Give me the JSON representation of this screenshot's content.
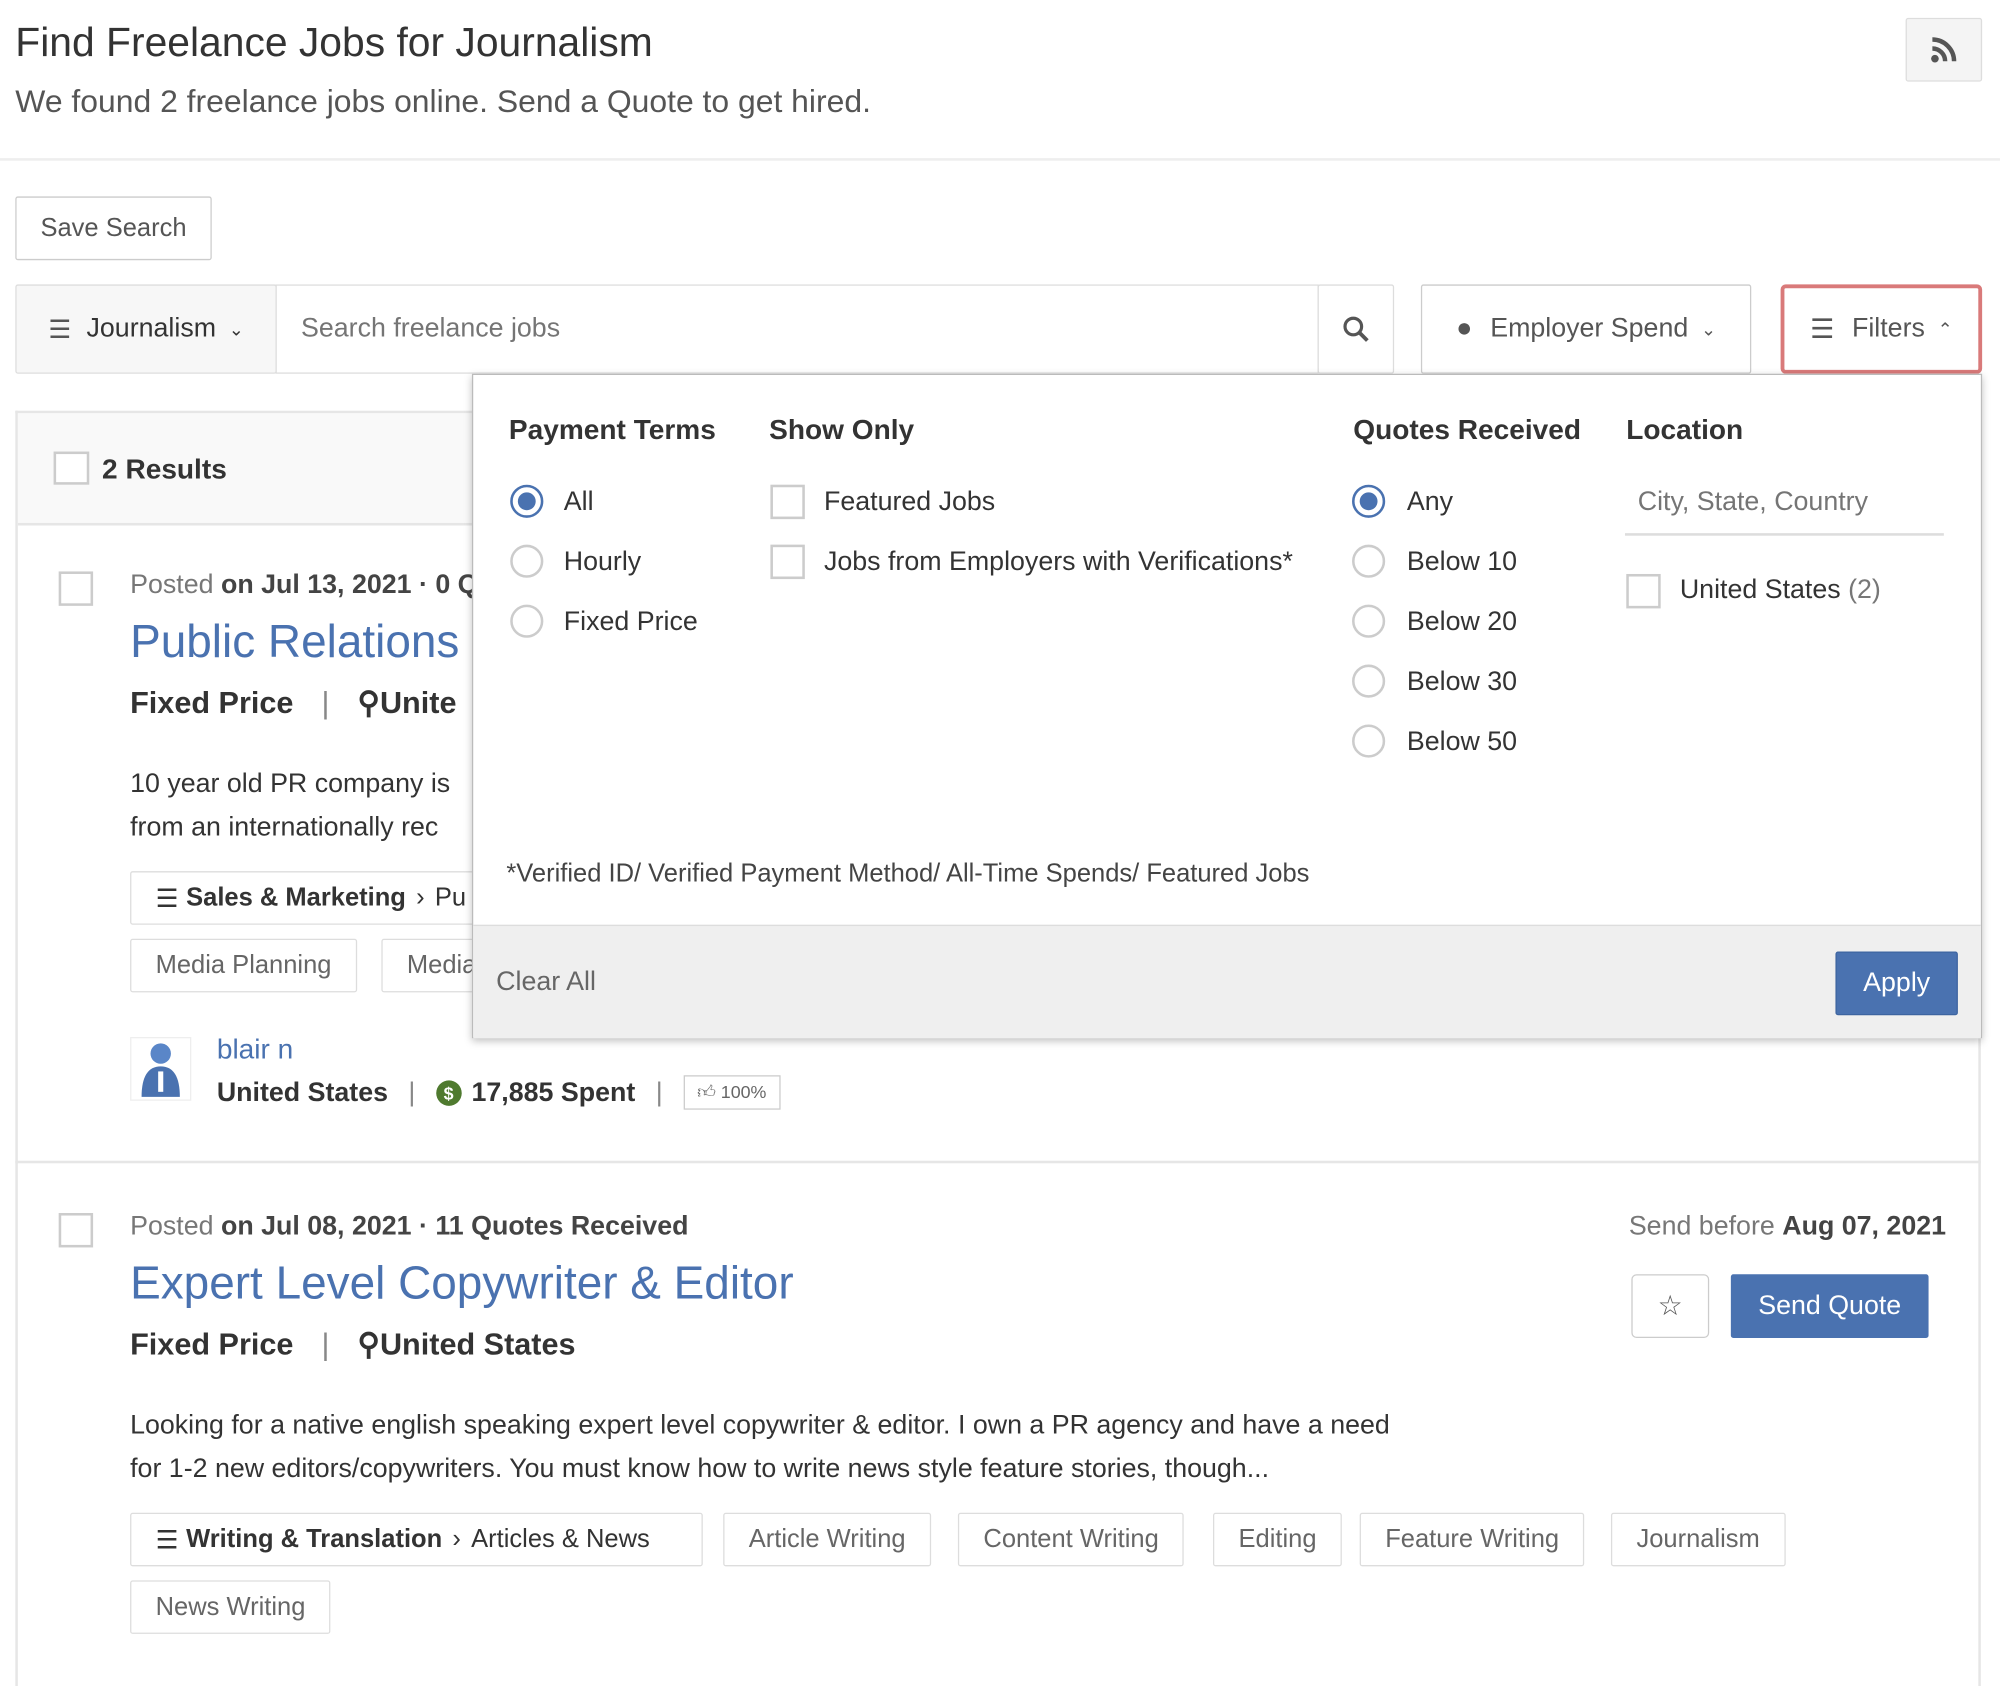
{
  "header": {
    "title": "Find Freelance Jobs for Journalism",
    "subtitle": "We found 2 freelance jobs online. Send a Quote to get hired.",
    "rss_icon": "rss-icon"
  },
  "toolbar": {
    "save_search": "Save Search",
    "category": "Journalism",
    "search_placeholder": "Search freelance jobs",
    "employer_spend": "Employer Spend",
    "filters": "Filters"
  },
  "results": {
    "count_label": "2 Results"
  },
  "filters": {
    "payment_terms": {
      "title": "Payment Terms",
      "options": [
        "All",
        "Hourly",
        "Fixed Price"
      ],
      "selected": "All"
    },
    "show_only": {
      "title": "Show Only",
      "options": [
        "Featured Jobs",
        "Jobs from Employers with Verifications*"
      ]
    },
    "quotes_received": {
      "title": "Quotes Received",
      "options": [
        "Any",
        "Below 10",
        "Below 20",
        "Below 30",
        "Below 50"
      ],
      "selected": "Any"
    },
    "location": {
      "title": "Location",
      "placeholder": "City, State, Country",
      "option": "United States",
      "option_count": "(2)"
    },
    "footnote": "*Verified ID/ Verified Payment Method/ All-Time Spends/ Featured Jobs",
    "clear_all": "Clear All",
    "apply": "Apply"
  },
  "jobs": [
    {
      "posted_prefix": "Posted",
      "posted_on": "on Jul 13, 2021 · 0 Q",
      "title": "Public Relations",
      "type": "Fixed Price",
      "location": "Unite",
      "desc1": "10 year old PR company is",
      "desc2": "from an internationally rec",
      "category": "Sales & Marketing",
      "subcategory": "Pu",
      "skills": [
        "Media Planning",
        "Media"
      ],
      "employer": {
        "name": "blair n",
        "country": "United States",
        "spent": "17,885 Spent",
        "rating": "100%"
      }
    },
    {
      "posted_prefix": "Posted",
      "posted_on": "on Jul 08, 2021",
      "quotes": "· 11 Quotes Received",
      "title": "Expert Level Copywriter & Editor",
      "type": "Fixed Price",
      "location": "United States",
      "desc1": "Looking for a native english speaking expert level copywriter & editor. I own a PR agency and have a need",
      "desc2": "for 1-2 new editors/copywriters. You must know how to write news style feature stories, though...",
      "category": "Writing & Translation",
      "subcategory": "Articles & News",
      "skills": [
        "Article Writing",
        "Content Writing",
        "Editing",
        "Feature Writing",
        "Journalism",
        "News Writing"
      ],
      "send_before_label": "Send before",
      "send_before_date": "Aug 07, 2021",
      "send_quote": "Send Quote"
    }
  ],
  "colors": {
    "accent": "#4a72b0",
    "filters_border": "#d97a7a",
    "spent_icon": "#4f7a2f"
  }
}
